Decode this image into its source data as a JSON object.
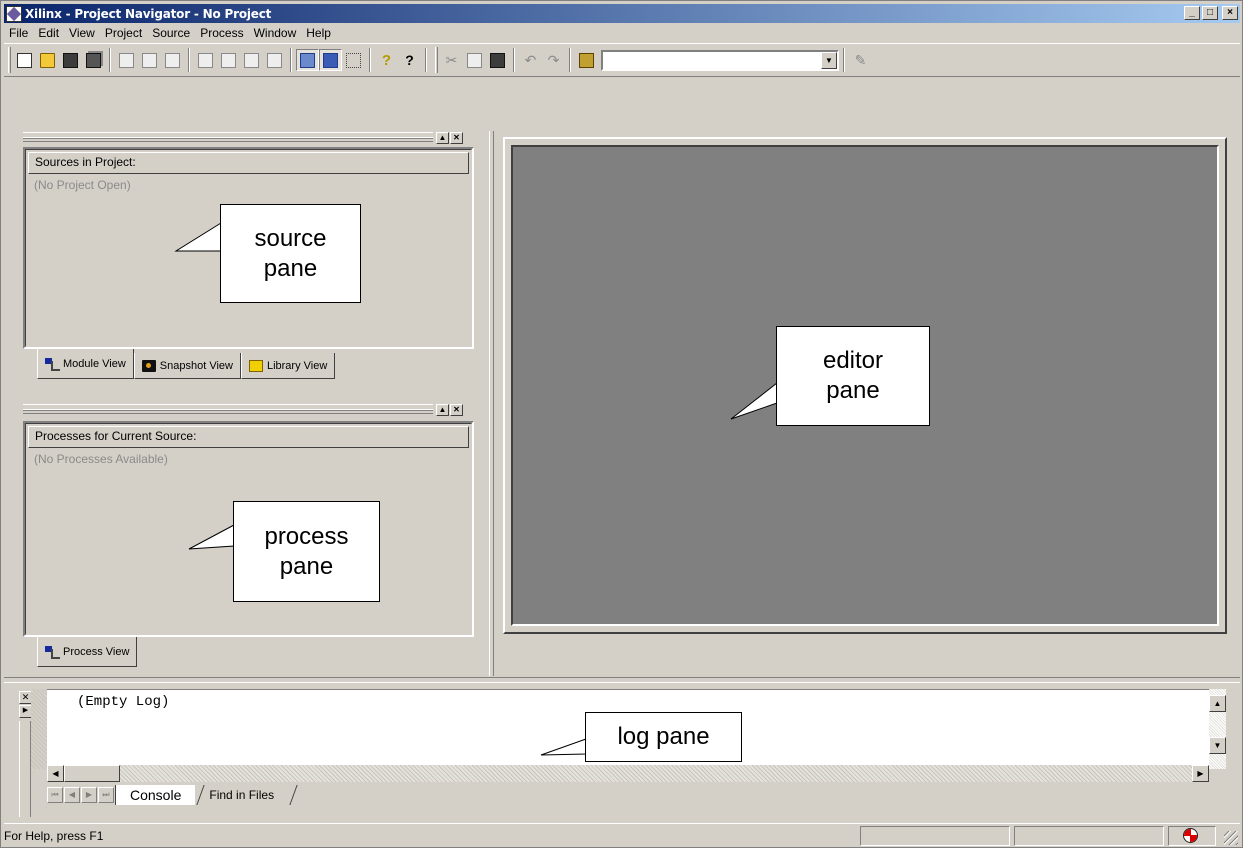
{
  "window": {
    "title": "Xilinx - Project Navigator - No Project",
    "min_glyph": "_",
    "max_glyph": "□",
    "close_glyph": "×"
  },
  "menu": [
    "File",
    "Edit",
    "View",
    "Project",
    "Source",
    "Process",
    "Window",
    "Help"
  ],
  "toolbar": {
    "search_value": "",
    "help_label": "?",
    "whats_this_label": "?"
  },
  "sources_pane": {
    "header": "Sources in Project:",
    "empty_text": "(No Project Open)",
    "tabs": [
      "Module View",
      "Snapshot View",
      "Library View"
    ]
  },
  "processes_pane": {
    "header": "Processes for Current Source:",
    "empty_text": "(No Processes Available)",
    "tabs": [
      "Process View"
    ]
  },
  "log_pane": {
    "text": "(Empty Log)",
    "tabs": [
      "Console",
      "Find in Files"
    ]
  },
  "status_bar": {
    "text": "For Help, press F1"
  },
  "annotations": {
    "source_pane": "source pane",
    "editor_pane": "editor pane",
    "process_pane": "process pane",
    "log_pane": "log pane"
  },
  "colors": {
    "titlebar_start": "#0a246a",
    "titlebar_end": "#a6caf0",
    "chrome": "#d4d0c8",
    "editor_bg": "#808080"
  }
}
